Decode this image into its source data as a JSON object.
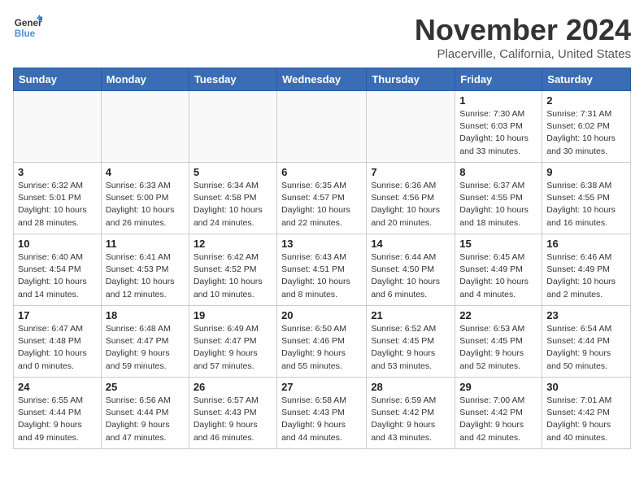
{
  "logo": {
    "line1": "General",
    "line2": "Blue"
  },
  "title": "November 2024",
  "subtitle": "Placerville, California, United States",
  "weekdays": [
    "Sunday",
    "Monday",
    "Tuesday",
    "Wednesday",
    "Thursday",
    "Friday",
    "Saturday"
  ],
  "weeks": [
    [
      {
        "day": "",
        "info": ""
      },
      {
        "day": "",
        "info": ""
      },
      {
        "day": "",
        "info": ""
      },
      {
        "day": "",
        "info": ""
      },
      {
        "day": "",
        "info": ""
      },
      {
        "day": "1",
        "info": "Sunrise: 7:30 AM\nSunset: 6:03 PM\nDaylight: 10 hours\nand 33 minutes."
      },
      {
        "day": "2",
        "info": "Sunrise: 7:31 AM\nSunset: 6:02 PM\nDaylight: 10 hours\nand 30 minutes."
      }
    ],
    [
      {
        "day": "3",
        "info": "Sunrise: 6:32 AM\nSunset: 5:01 PM\nDaylight: 10 hours\nand 28 minutes."
      },
      {
        "day": "4",
        "info": "Sunrise: 6:33 AM\nSunset: 5:00 PM\nDaylight: 10 hours\nand 26 minutes."
      },
      {
        "day": "5",
        "info": "Sunrise: 6:34 AM\nSunset: 4:58 PM\nDaylight: 10 hours\nand 24 minutes."
      },
      {
        "day": "6",
        "info": "Sunrise: 6:35 AM\nSunset: 4:57 PM\nDaylight: 10 hours\nand 22 minutes."
      },
      {
        "day": "7",
        "info": "Sunrise: 6:36 AM\nSunset: 4:56 PM\nDaylight: 10 hours\nand 20 minutes."
      },
      {
        "day": "8",
        "info": "Sunrise: 6:37 AM\nSunset: 4:55 PM\nDaylight: 10 hours\nand 18 minutes."
      },
      {
        "day": "9",
        "info": "Sunrise: 6:38 AM\nSunset: 4:55 PM\nDaylight: 10 hours\nand 16 minutes."
      }
    ],
    [
      {
        "day": "10",
        "info": "Sunrise: 6:40 AM\nSunset: 4:54 PM\nDaylight: 10 hours\nand 14 minutes."
      },
      {
        "day": "11",
        "info": "Sunrise: 6:41 AM\nSunset: 4:53 PM\nDaylight: 10 hours\nand 12 minutes."
      },
      {
        "day": "12",
        "info": "Sunrise: 6:42 AM\nSunset: 4:52 PM\nDaylight: 10 hours\nand 10 minutes."
      },
      {
        "day": "13",
        "info": "Sunrise: 6:43 AM\nSunset: 4:51 PM\nDaylight: 10 hours\nand 8 minutes."
      },
      {
        "day": "14",
        "info": "Sunrise: 6:44 AM\nSunset: 4:50 PM\nDaylight: 10 hours\nand 6 minutes."
      },
      {
        "day": "15",
        "info": "Sunrise: 6:45 AM\nSunset: 4:49 PM\nDaylight: 10 hours\nand 4 minutes."
      },
      {
        "day": "16",
        "info": "Sunrise: 6:46 AM\nSunset: 4:49 PM\nDaylight: 10 hours\nand 2 minutes."
      }
    ],
    [
      {
        "day": "17",
        "info": "Sunrise: 6:47 AM\nSunset: 4:48 PM\nDaylight: 10 hours\nand 0 minutes."
      },
      {
        "day": "18",
        "info": "Sunrise: 6:48 AM\nSunset: 4:47 PM\nDaylight: 9 hours\nand 59 minutes."
      },
      {
        "day": "19",
        "info": "Sunrise: 6:49 AM\nSunset: 4:47 PM\nDaylight: 9 hours\nand 57 minutes."
      },
      {
        "day": "20",
        "info": "Sunrise: 6:50 AM\nSunset: 4:46 PM\nDaylight: 9 hours\nand 55 minutes."
      },
      {
        "day": "21",
        "info": "Sunrise: 6:52 AM\nSunset: 4:45 PM\nDaylight: 9 hours\nand 53 minutes."
      },
      {
        "day": "22",
        "info": "Sunrise: 6:53 AM\nSunset: 4:45 PM\nDaylight: 9 hours\nand 52 minutes."
      },
      {
        "day": "23",
        "info": "Sunrise: 6:54 AM\nSunset: 4:44 PM\nDaylight: 9 hours\nand 50 minutes."
      }
    ],
    [
      {
        "day": "24",
        "info": "Sunrise: 6:55 AM\nSunset: 4:44 PM\nDaylight: 9 hours\nand 49 minutes."
      },
      {
        "day": "25",
        "info": "Sunrise: 6:56 AM\nSunset: 4:44 PM\nDaylight: 9 hours\nand 47 minutes."
      },
      {
        "day": "26",
        "info": "Sunrise: 6:57 AM\nSunset: 4:43 PM\nDaylight: 9 hours\nand 46 minutes."
      },
      {
        "day": "27",
        "info": "Sunrise: 6:58 AM\nSunset: 4:43 PM\nDaylight: 9 hours\nand 44 minutes."
      },
      {
        "day": "28",
        "info": "Sunrise: 6:59 AM\nSunset: 4:42 PM\nDaylight: 9 hours\nand 43 minutes."
      },
      {
        "day": "29",
        "info": "Sunrise: 7:00 AM\nSunset: 4:42 PM\nDaylight: 9 hours\nand 42 minutes."
      },
      {
        "day": "30",
        "info": "Sunrise: 7:01 AM\nSunset: 4:42 PM\nDaylight: 9 hours\nand 40 minutes."
      }
    ]
  ]
}
